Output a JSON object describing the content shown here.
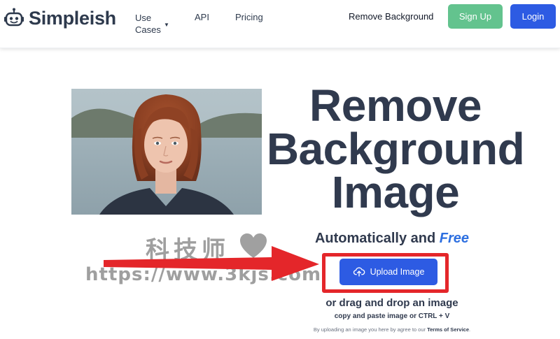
{
  "header": {
    "brand": {
      "prefix": "Simple",
      "accent": "i",
      "suffix": "sh"
    },
    "nav": {
      "use_cases_line1": "Use",
      "use_cases_line2": "Cases",
      "api": "API",
      "pricing": "Pricing",
      "remove_background": "Remove Background"
    },
    "signup_label": "Sign Up",
    "login_label": "Login"
  },
  "hero": {
    "headline_line1": "Remove",
    "headline_line2": "Background",
    "headline_line3": "Image",
    "subhead_prefix": "Automatically and ",
    "subhead_free": "Free",
    "upload_label": "Upload Image",
    "drag_text": "or drag and drop an image",
    "paste_text": "copy and paste image or CTRL + V",
    "terms_prefix": "By uploading an image you here by agree to our ",
    "terms_link": "Terms of Service",
    "terms_suffix": "."
  },
  "overlay": {
    "watermark_cn": "科技师",
    "watermark_url": "https://www.3kjs.com"
  },
  "colors": {
    "brand_dark": "#303a4e",
    "signup_green": "#63c38e",
    "primary_blue": "#2d5be3",
    "free_blue": "#2d6fe0",
    "annotation_red": "#e4262a"
  },
  "icons": {
    "logo": "robot-icon",
    "dropdown": "chevron-down-icon",
    "upload": "cloud-upload-icon",
    "heart": "heart-icon"
  }
}
